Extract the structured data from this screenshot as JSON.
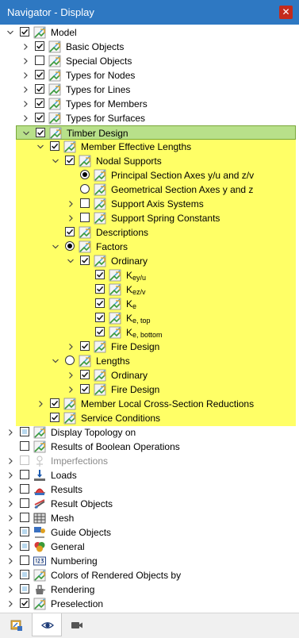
{
  "window": {
    "title": "Navigator - Display",
    "close_glyph": "✕"
  },
  "colors": {
    "titlebar": "#2e78c2",
    "highlight": "#ffff66",
    "selected_row": "#b8e08a",
    "check": "#1a1a1a"
  },
  "tree": [
    {
      "label": "Model",
      "level": 0,
      "expander": "down",
      "control": "check",
      "state": "checked",
      "icon": "model-icon"
    },
    {
      "label": "Basic Objects",
      "level": 1,
      "expander": "right",
      "control": "check",
      "state": "checked",
      "icon": "model-icon"
    },
    {
      "label": "Special Objects",
      "level": 1,
      "expander": "right",
      "control": "check",
      "state": "unchecked",
      "icon": "model-icon"
    },
    {
      "label": "Types for Nodes",
      "level": 1,
      "expander": "right",
      "control": "check",
      "state": "checked",
      "icon": "model-icon"
    },
    {
      "label": "Types for Lines",
      "level": 1,
      "expander": "right",
      "control": "check",
      "state": "checked",
      "icon": "model-icon"
    },
    {
      "label": "Types for Members",
      "level": 1,
      "expander": "right",
      "control": "check",
      "state": "checked",
      "icon": "model-icon"
    },
    {
      "label": "Types for Surfaces",
      "level": 1,
      "expander": "right",
      "control": "check",
      "state": "checked",
      "icon": "model-icon"
    },
    {
      "label": "Timber Design",
      "level": 1,
      "expander": "down",
      "control": "check",
      "state": "checked",
      "icon": "model-icon",
      "selected": true
    },
    {
      "label": "Member Effective Lengths",
      "level": 2,
      "expander": "down",
      "control": "check",
      "state": "checked",
      "icon": "model-icon"
    },
    {
      "label": "Nodal Supports",
      "level": 3,
      "expander": "down",
      "control": "check",
      "state": "checked",
      "icon": "model-icon"
    },
    {
      "label": "Principal Section Axes y/u and z/v",
      "level": 4,
      "expander": "none",
      "control": "radio",
      "state": "on",
      "icon": "model-icon"
    },
    {
      "label": "Geometrical Section Axes y and z",
      "level": 4,
      "expander": "none",
      "control": "radio",
      "state": "off",
      "icon": "model-icon"
    },
    {
      "label": "Support Axis Systems",
      "level": 4,
      "expander": "right",
      "control": "check",
      "state": "unchecked",
      "icon": "model-icon"
    },
    {
      "label": "Support Spring Constants",
      "level": 4,
      "expander": "right",
      "control": "check",
      "state": "unchecked",
      "icon": "model-icon"
    },
    {
      "label": "Descriptions",
      "level": 3,
      "expander": "none",
      "control": "check",
      "state": "checked",
      "icon": "model-icon"
    },
    {
      "label": "Factors",
      "level": 3,
      "expander": "down",
      "control": "radio",
      "state": "on",
      "icon": "model-icon"
    },
    {
      "label": "Ordinary",
      "level": 4,
      "expander": "down",
      "control": "check",
      "state": "checked",
      "icon": "model-icon"
    },
    {
      "label": "K",
      "sub": "ey/u",
      "level": 5,
      "expander": "none",
      "control": "check",
      "state": "checked",
      "icon": "model-icon"
    },
    {
      "label": "K",
      "sub": "ez/v",
      "level": 5,
      "expander": "none",
      "control": "check",
      "state": "checked",
      "icon": "model-icon"
    },
    {
      "label": "K",
      "sub": "e",
      "level": 5,
      "expander": "none",
      "control": "check",
      "state": "checked",
      "icon": "model-icon"
    },
    {
      "label": "K",
      "sub": "e, top",
      "level": 5,
      "expander": "none",
      "control": "check",
      "state": "checked",
      "icon": "model-icon"
    },
    {
      "label": "K",
      "sub": "e, bottom",
      "level": 5,
      "expander": "none",
      "control": "check",
      "state": "checked",
      "icon": "model-icon"
    },
    {
      "label": "Fire Design",
      "level": 4,
      "expander": "right",
      "control": "check",
      "state": "checked",
      "icon": "model-icon"
    },
    {
      "label": "Lengths",
      "level": 3,
      "expander": "down",
      "control": "radio",
      "state": "off",
      "icon": "model-icon"
    },
    {
      "label": "Ordinary",
      "level": 4,
      "expander": "right",
      "control": "check",
      "state": "checked",
      "icon": "model-icon"
    },
    {
      "label": "Fire Design",
      "level": 4,
      "expander": "right",
      "control": "check",
      "state": "checked",
      "icon": "model-icon"
    },
    {
      "label": "Member Local Cross-Section Reductions",
      "level": 2,
      "expander": "right",
      "control": "check",
      "state": "checked",
      "icon": "model-icon"
    },
    {
      "label": "Service Conditions",
      "level": 2,
      "expander": "none",
      "control": "check",
      "state": "checked",
      "icon": "model-icon"
    },
    {
      "label": "Display Topology on",
      "level": 0,
      "expander": "right",
      "control": "check",
      "state": "partial",
      "icon": "model-icon"
    },
    {
      "label": "Results of Boolean Operations",
      "level": 0,
      "expander": "none",
      "control": "check",
      "state": "unchecked",
      "icon": "model-icon"
    },
    {
      "label": "Imperfections",
      "level": 0,
      "expander": "right",
      "control": "check",
      "state": "disabled",
      "icon": "imperfections-icon"
    },
    {
      "label": "Loads",
      "level": 0,
      "expander": "right",
      "control": "check",
      "state": "unchecked",
      "icon": "loads-icon"
    },
    {
      "label": "Results",
      "level": 0,
      "expander": "right",
      "control": "check",
      "state": "unchecked",
      "icon": "results-icon"
    },
    {
      "label": "Result Objects",
      "level": 0,
      "expander": "right",
      "control": "check",
      "state": "unchecked",
      "icon": "result-objects-icon"
    },
    {
      "label": "Mesh",
      "level": 0,
      "expander": "right",
      "control": "check",
      "state": "unchecked",
      "icon": "mesh-icon"
    },
    {
      "label": "Guide Objects",
      "level": 0,
      "expander": "right",
      "control": "check",
      "state": "partial",
      "icon": "guide-objects-icon"
    },
    {
      "label": "General",
      "level": 0,
      "expander": "right",
      "control": "check",
      "state": "partial",
      "icon": "general-icon"
    },
    {
      "label": "Numbering",
      "level": 0,
      "expander": "right",
      "control": "check",
      "state": "unchecked",
      "icon": "numbering-icon"
    },
    {
      "label": "Colors of Rendered Objects by",
      "level": 0,
      "expander": "right",
      "control": "check",
      "state": "partial",
      "icon": "model-icon"
    },
    {
      "label": "Rendering",
      "level": 0,
      "expander": "right",
      "control": "check",
      "state": "partial",
      "icon": "rendering-icon"
    },
    {
      "label": "Preselection",
      "level": 0,
      "expander": "right",
      "control": "check",
      "state": "checked",
      "icon": "model-icon"
    }
  ],
  "tabs": [
    {
      "name": "data-tab",
      "icon": "data-navigator-icon",
      "active": false
    },
    {
      "name": "display-tab",
      "icon": "eye-icon",
      "active": true
    },
    {
      "name": "views-tab",
      "icon": "camera-icon",
      "active": false
    }
  ]
}
